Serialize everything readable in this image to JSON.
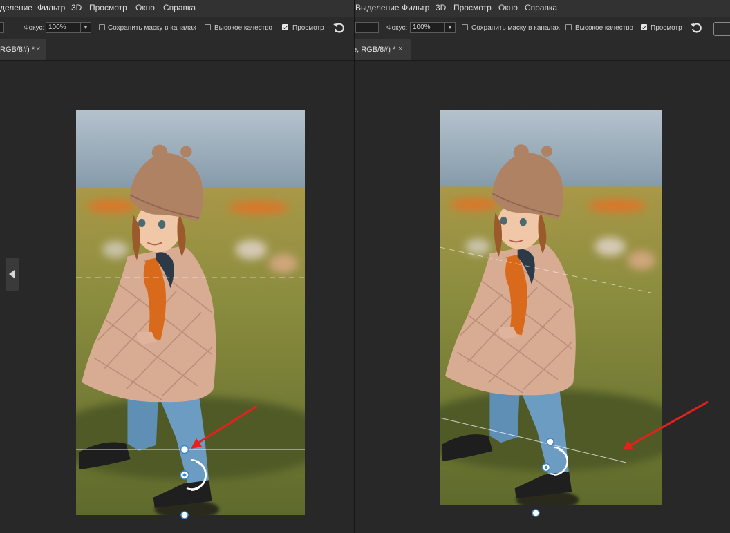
{
  "left": {
    "menu": [
      "деление",
      "Фильтр",
      "3D",
      "Просмотр",
      "Окно",
      "Справка"
    ],
    "options": {
      "focus_label": "Фокус:",
      "focus_value": "100%",
      "save_mask_label": "Сохранить маску в каналах",
      "save_mask_checked": false,
      "high_quality_label": "Высокое качество",
      "high_quality_checked": false,
      "preview_label": "Просмотр",
      "preview_checked": true
    },
    "tab": {
      "title": "RGB/8#) *",
      "close": "×"
    }
  },
  "right": {
    "menu": [
      "Выделение",
      "Фильтр",
      "3D",
      "Просмотр",
      "Окно",
      "Справка"
    ],
    "options": {
      "focus_label": "Фокус:",
      "focus_value": "100%",
      "save_mask_label": "Сохранить маску в каналах",
      "save_mask_checked": false,
      "high_quality_label": "Высокое качество",
      "high_quality_checked": false,
      "preview_label": "Просмотр",
      "preview_checked": true
    },
    "tab": {
      "title": "e, RGB/8#) *",
      "close": "×"
    }
  },
  "colors": {
    "annotation_arrow": "#e8201c",
    "handle": "#ffffff",
    "handle_ring": "#3b86c9"
  },
  "icons": {
    "reset": "rotate-ccw-icon",
    "panel_toggle": "triangle-left-icon"
  }
}
